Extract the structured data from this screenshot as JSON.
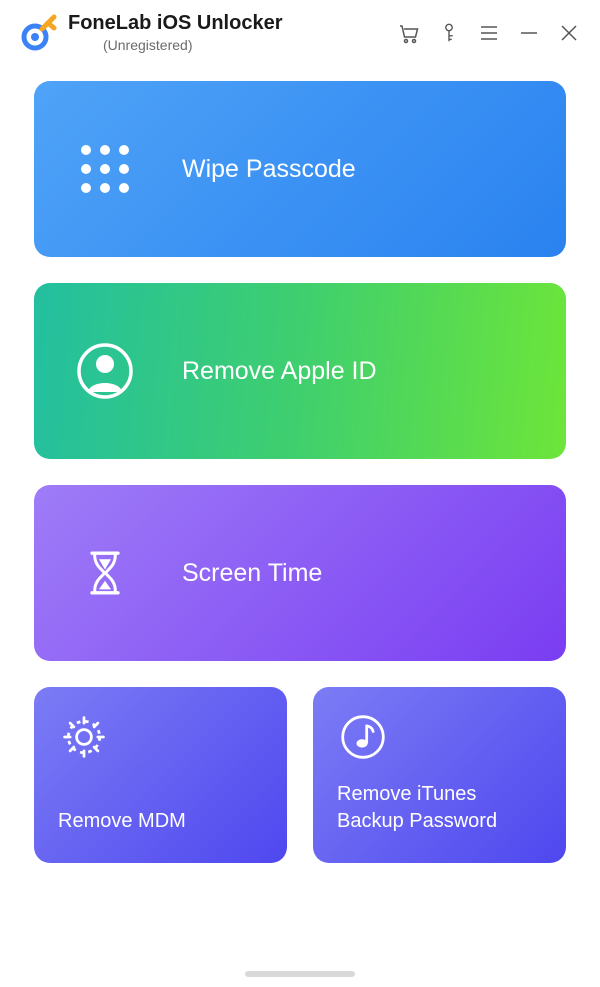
{
  "header": {
    "title": "FoneLab iOS Unlocker",
    "subtitle": "(Unregistered)"
  },
  "cards": {
    "wipe": {
      "label": "Wipe Passcode"
    },
    "appleid": {
      "label": "Remove Apple ID"
    },
    "screentime": {
      "label": "Screen Time"
    },
    "mdm": {
      "label": "Remove MDM"
    },
    "itunes": {
      "label": "Remove iTunes\nBackup Password"
    }
  }
}
